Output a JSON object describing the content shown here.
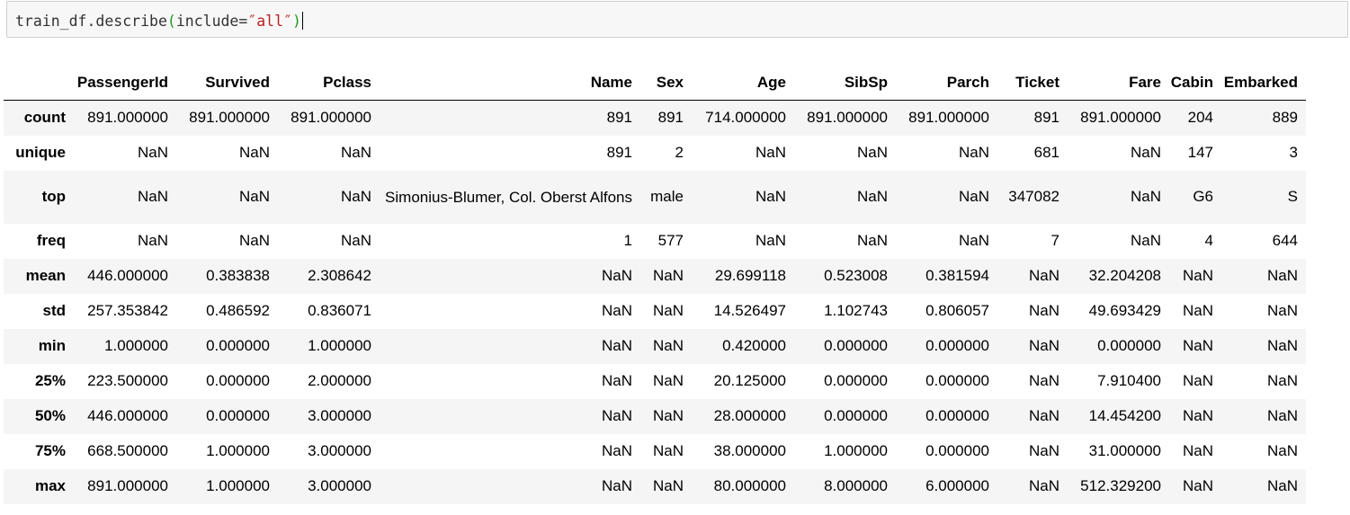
{
  "code": {
    "prefix": "train_df.describe",
    "open_paren": "(",
    "arg": "include=",
    "string": "″all″",
    "close_paren": ")"
  },
  "table": {
    "columns": [
      "PassengerId",
      "Survived",
      "Pclass",
      "Name",
      "Sex",
      "Age",
      "SibSp",
      "Parch",
      "Ticket",
      "Fare",
      "Cabin",
      "Embarked"
    ],
    "rows": [
      {
        "index": "count",
        "cells": [
          "891.000000",
          "891.000000",
          "891.000000",
          "891",
          "891",
          "714.000000",
          "891.000000",
          "891.000000",
          "891",
          "891.000000",
          "204",
          "889"
        ]
      },
      {
        "index": "unique",
        "cells": [
          "NaN",
          "NaN",
          "NaN",
          "891",
          "2",
          "NaN",
          "NaN",
          "NaN",
          "681",
          "NaN",
          "147",
          "3"
        ]
      },
      {
        "index": "top",
        "cells": [
          "NaN",
          "NaN",
          "NaN",
          "Simonius-Blumer, Col. Oberst Alfons",
          "male",
          "NaN",
          "NaN",
          "NaN",
          "347082",
          "NaN",
          "G6",
          "S"
        ]
      },
      {
        "index": "freq",
        "cells": [
          "NaN",
          "NaN",
          "NaN",
          "1",
          "577",
          "NaN",
          "NaN",
          "NaN",
          "7",
          "NaN",
          "4",
          "644"
        ]
      },
      {
        "index": "mean",
        "cells": [
          "446.000000",
          "0.383838",
          "2.308642",
          "NaN",
          "NaN",
          "29.699118",
          "0.523008",
          "0.381594",
          "NaN",
          "32.204208",
          "NaN",
          "NaN"
        ]
      },
      {
        "index": "std",
        "cells": [
          "257.353842",
          "0.486592",
          "0.836071",
          "NaN",
          "NaN",
          "14.526497",
          "1.102743",
          "0.806057",
          "NaN",
          "49.693429",
          "NaN",
          "NaN"
        ]
      },
      {
        "index": "min",
        "cells": [
          "1.000000",
          "0.000000",
          "1.000000",
          "NaN",
          "NaN",
          "0.420000",
          "0.000000",
          "0.000000",
          "NaN",
          "0.000000",
          "NaN",
          "NaN"
        ]
      },
      {
        "index": "25%",
        "cells": [
          "223.500000",
          "0.000000",
          "2.000000",
          "NaN",
          "NaN",
          "20.125000",
          "0.000000",
          "0.000000",
          "NaN",
          "7.910400",
          "NaN",
          "NaN"
        ]
      },
      {
        "index": "50%",
        "cells": [
          "446.000000",
          "0.000000",
          "3.000000",
          "NaN",
          "NaN",
          "28.000000",
          "0.000000",
          "0.000000",
          "NaN",
          "14.454200",
          "NaN",
          "NaN"
        ]
      },
      {
        "index": "75%",
        "cells": [
          "668.500000",
          "1.000000",
          "3.000000",
          "NaN",
          "NaN",
          "38.000000",
          "1.000000",
          "0.000000",
          "NaN",
          "31.000000",
          "NaN",
          "NaN"
        ]
      },
      {
        "index": "max",
        "cells": [
          "891.000000",
          "1.000000",
          "3.000000",
          "NaN",
          "NaN",
          "80.000000",
          "8.000000",
          "6.000000",
          "NaN",
          "512.329200",
          "NaN",
          "NaN"
        ]
      }
    ]
  }
}
